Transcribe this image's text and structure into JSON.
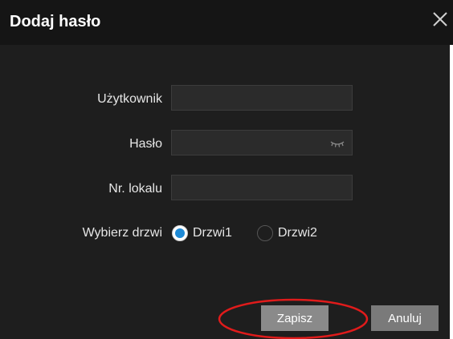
{
  "dialog": {
    "title": "Dodaj hasło",
    "close_icon": "close-icon"
  },
  "form": {
    "user_label": "Użytkownik",
    "user_value": "",
    "password_label": "Hasło",
    "password_value": "",
    "password_toggle_icon": "eye-closed-icon",
    "unit_label": "Nr. lokalu",
    "unit_value": "",
    "door_label": "Wybierz drzwi",
    "doors": [
      {
        "label": "Drzwi1",
        "selected": true
      },
      {
        "label": "Drzwi2",
        "selected": false
      }
    ]
  },
  "buttons": {
    "save_label": "Zapisz",
    "cancel_label": "Anuluj"
  },
  "colors": {
    "dialog_bg": "#1e1e1e",
    "titlebar_bg": "#151515",
    "radio_selected": "#1e8ad6",
    "annotation": "#e01b1b"
  }
}
